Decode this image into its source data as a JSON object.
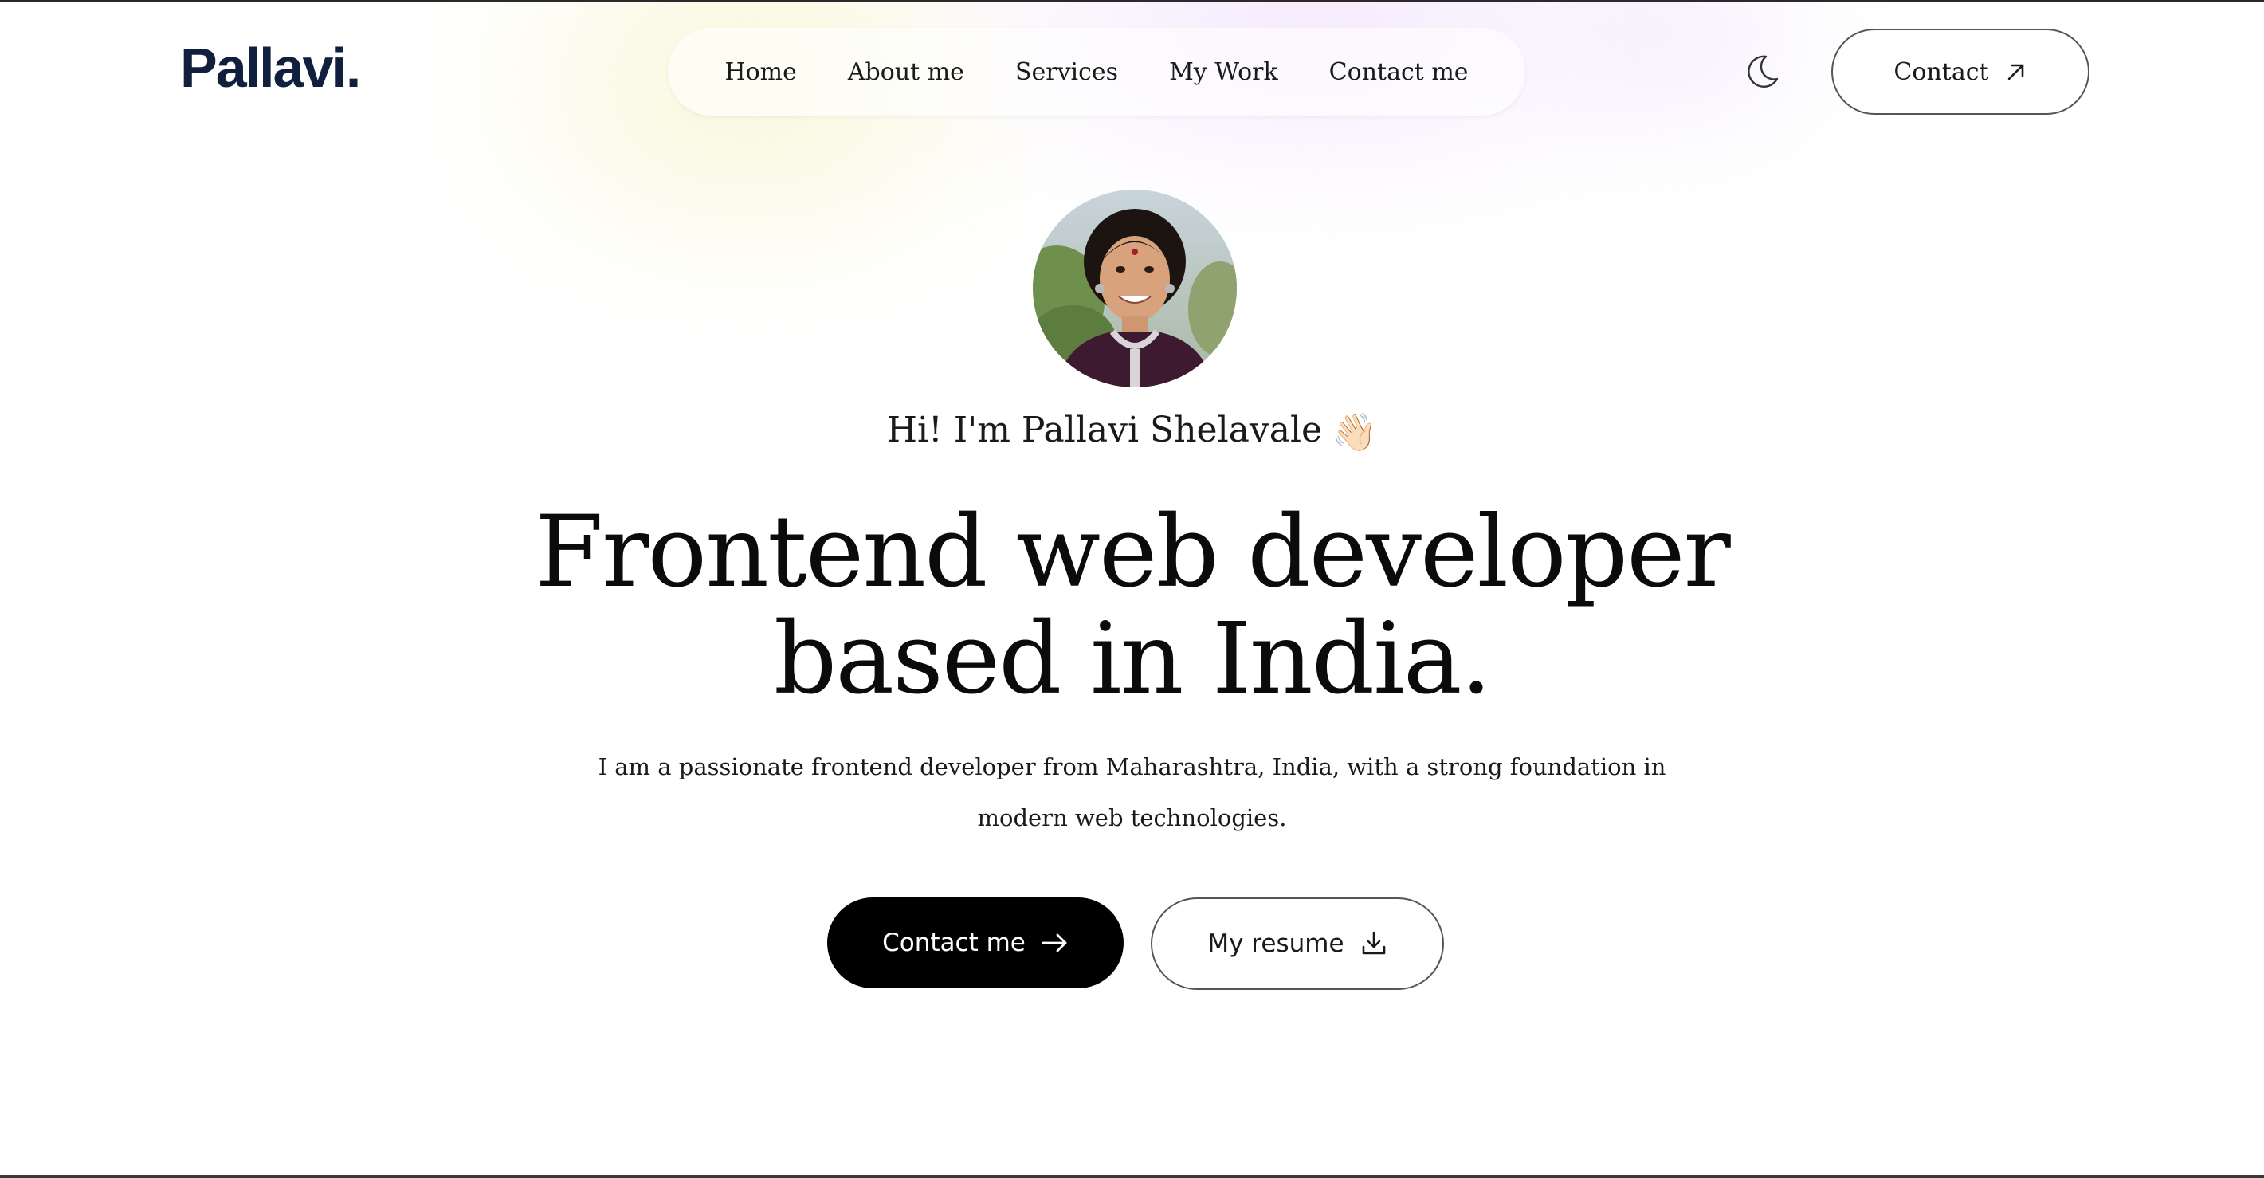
{
  "header": {
    "logo": "Pallavi.",
    "nav": [
      {
        "label": "Home"
      },
      {
        "label": "About me"
      },
      {
        "label": "Services"
      },
      {
        "label": "My Work"
      },
      {
        "label": "Contact me"
      }
    ],
    "theme_toggle_icon": "moon-icon",
    "contact_button": {
      "label": "Contact",
      "icon": "arrow-up-right-icon"
    }
  },
  "hero": {
    "avatar_alt": "profile-photo",
    "greeting": "Hi! I'm Pallavi Shelavale",
    "greeting_emoji": "👋🏻",
    "headline_line1": "Frontend web developer",
    "headline_line2": "based in India.",
    "bio": "I am a passionate frontend developer from Maharashtra, India, with a strong foundation in modern web technologies.",
    "primary_button": {
      "label": "Contact me",
      "icon": "arrow-right-icon"
    },
    "secondary_button": {
      "label": "My resume",
      "icon": "download-icon"
    }
  },
  "colors": {
    "logo": "#0f1f3d",
    "primary_button_bg": "#000000",
    "primary_button_text": "#ffffff",
    "text": "#111111",
    "glow_yellow": "#f6f6d2",
    "glow_lavender": "#f0e0fc"
  }
}
